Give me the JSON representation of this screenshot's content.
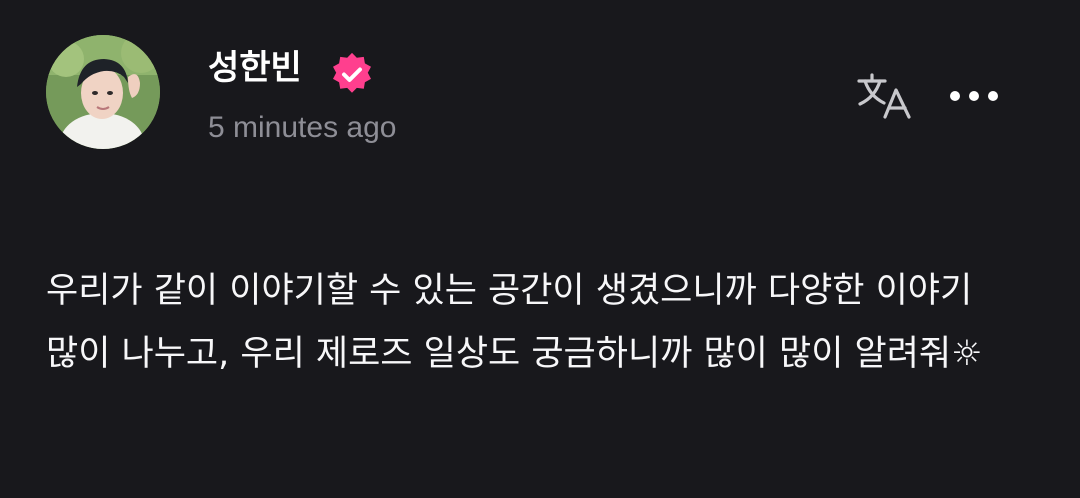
{
  "post": {
    "author": {
      "name": "성한빈",
      "verified": true,
      "avatar_icon": "profile-photo"
    },
    "timestamp": "5 minutes ago",
    "actions": {
      "translate_icon": "translate-icon",
      "more_icon": "more-horizontal-icon"
    },
    "body": "우리가 같이 이야기할 수 있는 공간이 생겼으니까 다양한 이야기 많이 나누고, 우리 제로즈 일상도 궁금하니까 많이 많이 알려줘☼"
  },
  "colors": {
    "background": "#18181c",
    "text": "#f7f7f9",
    "muted": "#8e8e96",
    "verified_badge": "#ff3f8e"
  }
}
